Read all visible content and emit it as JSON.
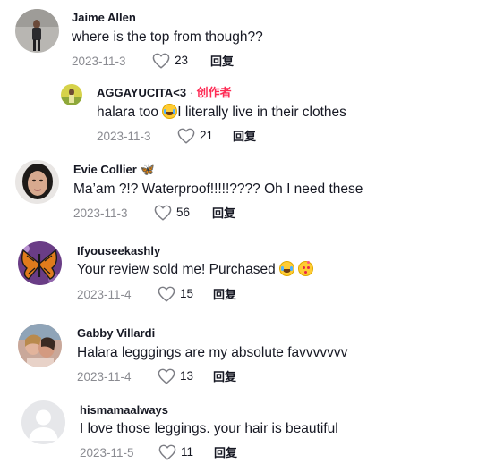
{
  "comments": [
    {
      "username": "Jaime Allen",
      "text": "where is the top from though??",
      "date": "2023-11-3",
      "likes": "23",
      "reply_label": "回复"
    },
    {
      "username": "AGGAYUCITA<3",
      "separator": "·",
      "creator_label": "创作者",
      "text_before": "halara too ",
      "text_after": "I literally live in their clothes",
      "date": "2023-11-3",
      "likes": "21",
      "reply_label": "回复"
    },
    {
      "username": "Evie Collier",
      "username_emoji": "butterfly",
      "text": "Ma’am ?!? Waterproof!!!!!???? Oh I need these",
      "date": "2023-11-3",
      "likes": "56",
      "reply_label": "回复"
    },
    {
      "username": "Ifyouseekashly",
      "text": "Your review sold me! Purchased ",
      "date": "2023-11-4",
      "likes": "15",
      "reply_label": "回复"
    },
    {
      "username": "Gabby Villardi",
      "text": "Halara legggings are my absolute favvvvvvv",
      "date": "2023-11-4",
      "likes": "13",
      "reply_label": "回复"
    },
    {
      "username": "hismamaalways",
      "text": "I love those leggings. your hair is beautiful",
      "date": "2023-11-5",
      "likes": "11",
      "reply_label": "回复"
    }
  ],
  "icons": {
    "like": "heart-outline-icon",
    "laugh": "tears-of-joy-emoji",
    "hearts": "smiling-face-with-hearts-emoji",
    "butterfly": "butterfly-emoji"
  },
  "colors": {
    "creator_tag": "#fe2c55",
    "meta_text": "#8a8b91",
    "primary_text": "#161823"
  }
}
